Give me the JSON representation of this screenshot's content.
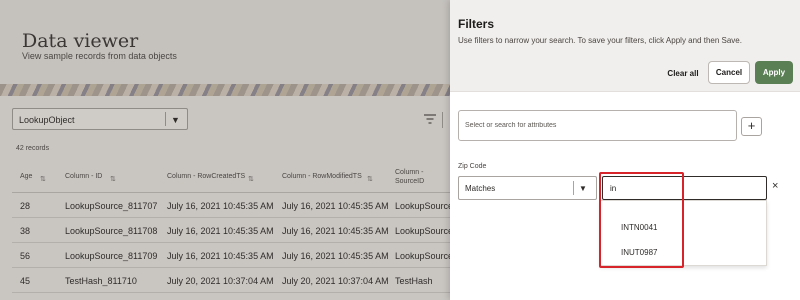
{
  "page": {
    "title": "Data viewer",
    "subtitle": "View sample records from data objects",
    "object_select": "LookupObject",
    "record_count": "42 records",
    "table": {
      "headers": [
        "Age",
        "Column - ID",
        "Column - RowCreatedTS",
        "Column - RowModifiedTS",
        "Column -\nSourceID"
      ],
      "rows": [
        [
          "28",
          "LookupSource_811707",
          "July 16, 2021 10:45:35 AM",
          "July 16, 2021 10:45:35 AM",
          "LookupSource"
        ],
        [
          "38",
          "LookupSource_811708",
          "July 16, 2021 10:45:35 AM",
          "July 16, 2021 10:45:35 AM",
          "LookupSource"
        ],
        [
          "56",
          "LookupSource_811709",
          "July 16, 2021 10:45:35 AM",
          "July 16, 2021 10:45:35 AM",
          "LookupSource"
        ],
        [
          "45",
          "TestHash_811710",
          "July 20, 2021 10:37:04 AM",
          "July 20, 2021 10:37:04 AM",
          "TestHash"
        ]
      ]
    }
  },
  "filters": {
    "title": "Filters",
    "description": "Use filters to narrow your search. To save your filters, click Apply and then Save.",
    "clear_all": "Clear all",
    "cancel": "Cancel",
    "apply": "Apply",
    "attr_placeholder": "Select or search for attributes",
    "add_icon": "+",
    "field_label": "Zip Code",
    "operator": "Matches",
    "value": "in",
    "remove_icon": "×",
    "suggestions": [
      "INTN0041",
      "INUT0987"
    ]
  },
  "colors": {
    "apply": "#5b7f55",
    "highlight": "#d7232a",
    "overlay": "#c9c6c2"
  },
  "icons": {
    "filter": "filter-icon",
    "chevron": "chevron-down-icon",
    "sort": "sort-icon",
    "add": "plus-icon",
    "remove": "close-icon"
  }
}
